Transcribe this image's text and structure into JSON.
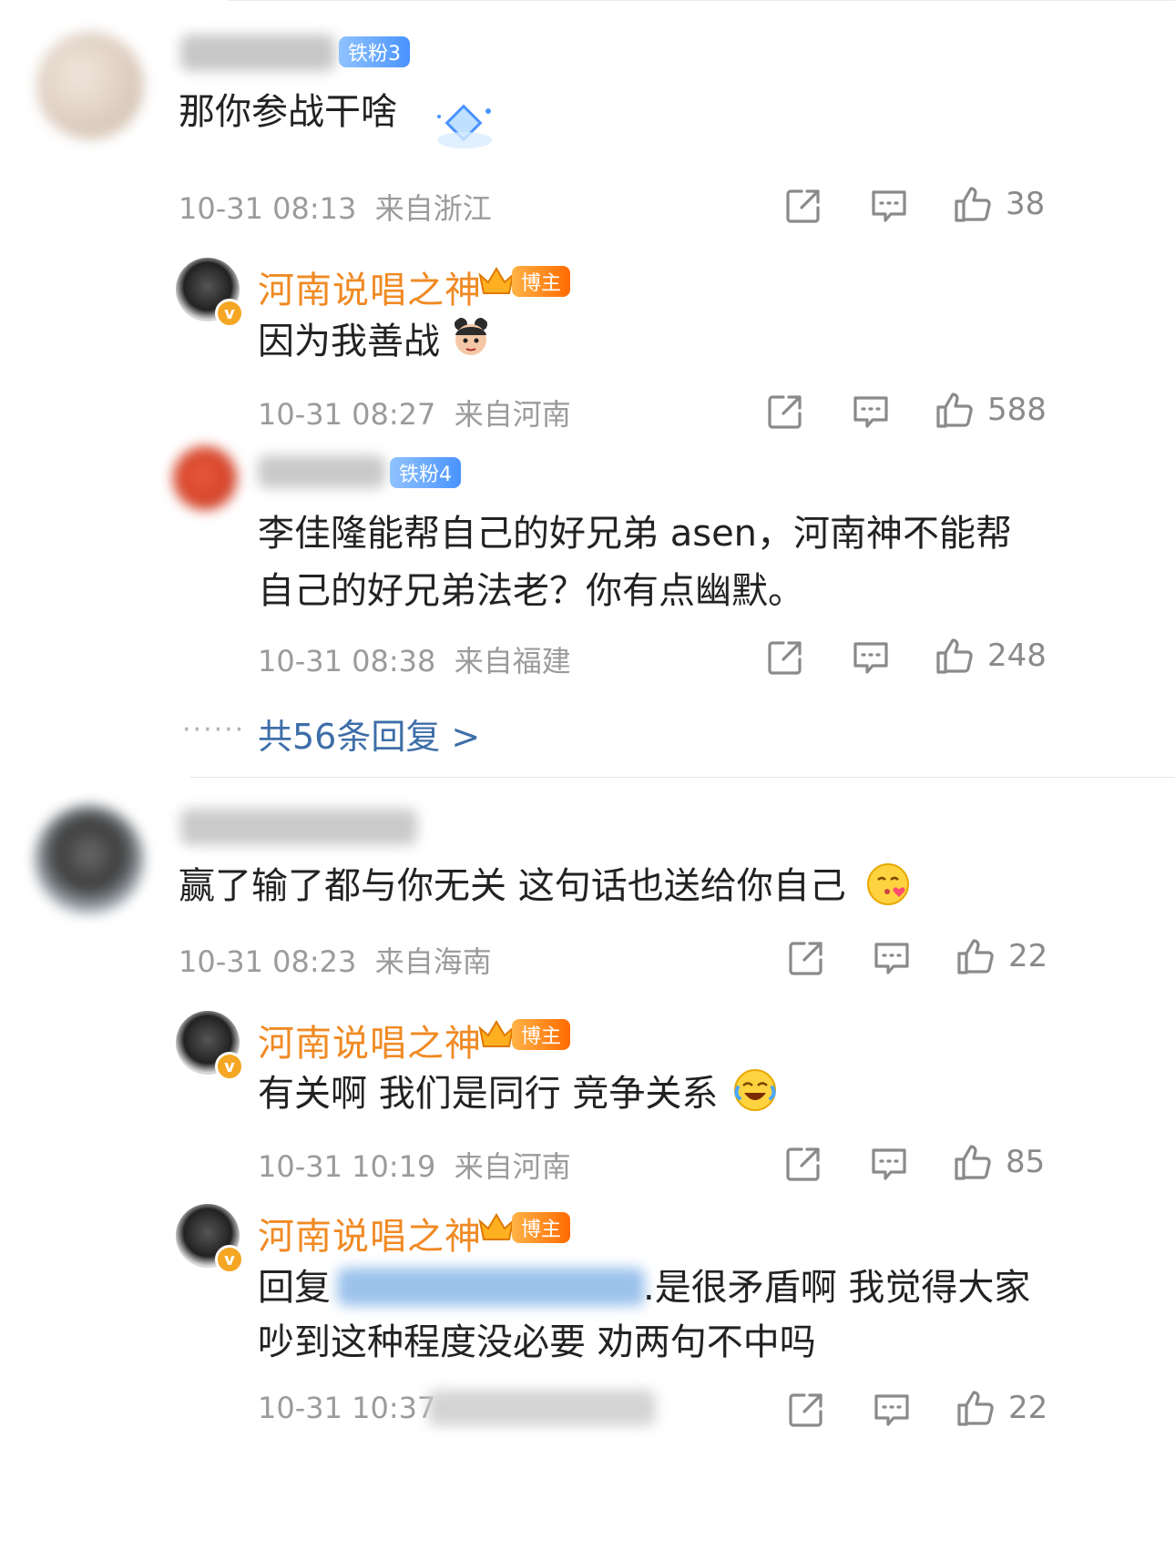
{
  "comments": [
    {
      "badge": "铁粉3",
      "text": "那你参战干啥",
      "time": "10-31 08:13",
      "location": "来自浙江",
      "likes": "38",
      "replies": [
        {
          "nick": "河南说唱之神",
          "badge": "博主",
          "text": "因为我善战",
          "time": "10-31 08:27",
          "location": "来自河南",
          "likes": "588"
        },
        {
          "badge": "铁粉4",
          "text_line1": "李佳隆能帮自己的好兄弟 asen，河南神不能帮",
          "text_line2": "自己的好兄弟法老？你有点幽默。",
          "time": "10-31 08:38",
          "location": "来自福建",
          "likes": "248"
        }
      ],
      "more": "共56条回复 >",
      "dots": "······"
    },
    {
      "text": "赢了输了都与你无关 这句话也送给你自己",
      "time": "10-31 08:23",
      "location": "来自海南",
      "likes": "22",
      "replies": [
        {
          "nick": "河南说唱之神",
          "badge": "博主",
          "text": "有关啊 我们是同行 竞争关系",
          "time": "10-31 10:19",
          "location": "来自河南",
          "likes": "85"
        },
        {
          "nick": "河南说唱之神",
          "badge": "博主",
          "text_prefix": "回复",
          "text_line1_suffix": ".是很矛盾啊 我觉得大家",
          "text_line2": "吵到这种程度没必要 劝两句不中吗",
          "time": "10-31 10:37",
          "likes": "22"
        }
      ]
    }
  ],
  "colors": {
    "nick": "#f08a24",
    "meta": "#9b9b9b",
    "link": "#3e6ea8",
    "fan_badge": "#4a93ff",
    "blogger_badge": "#ff6a00"
  },
  "icons": [
    "share-icon",
    "comment-icon",
    "like-icon"
  ]
}
